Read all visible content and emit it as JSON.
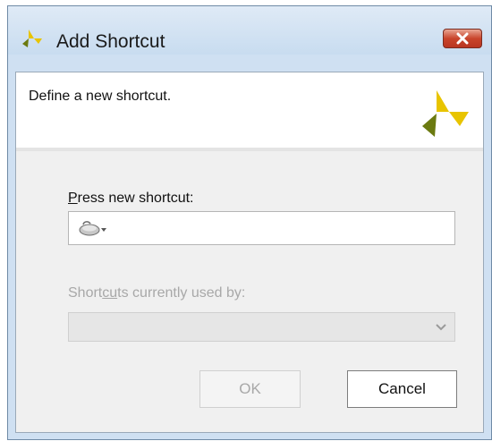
{
  "window": {
    "title": "Add Shortcut",
    "close_label": "Close"
  },
  "header": {
    "description": "Define a new shortcut."
  },
  "form": {
    "press_label_accel": "P",
    "press_label_rest": "ress new shortcut:",
    "used_by_label_pre": "Short",
    "used_by_label_accel": "cu",
    "used_by_label_post": "ts currently used by:",
    "used_by_value": ""
  },
  "buttons": {
    "ok": "OK",
    "cancel": "Cancel"
  },
  "icons": {
    "app": "xilinx-logo-icon",
    "input_mode": "mouse-icon",
    "dropdown": "chevron-down-icon",
    "close": "close-icon"
  },
  "colors": {
    "logo_yellow": "#e8c400",
    "logo_green": "#6b7a10",
    "close_red": "#c9452c"
  }
}
